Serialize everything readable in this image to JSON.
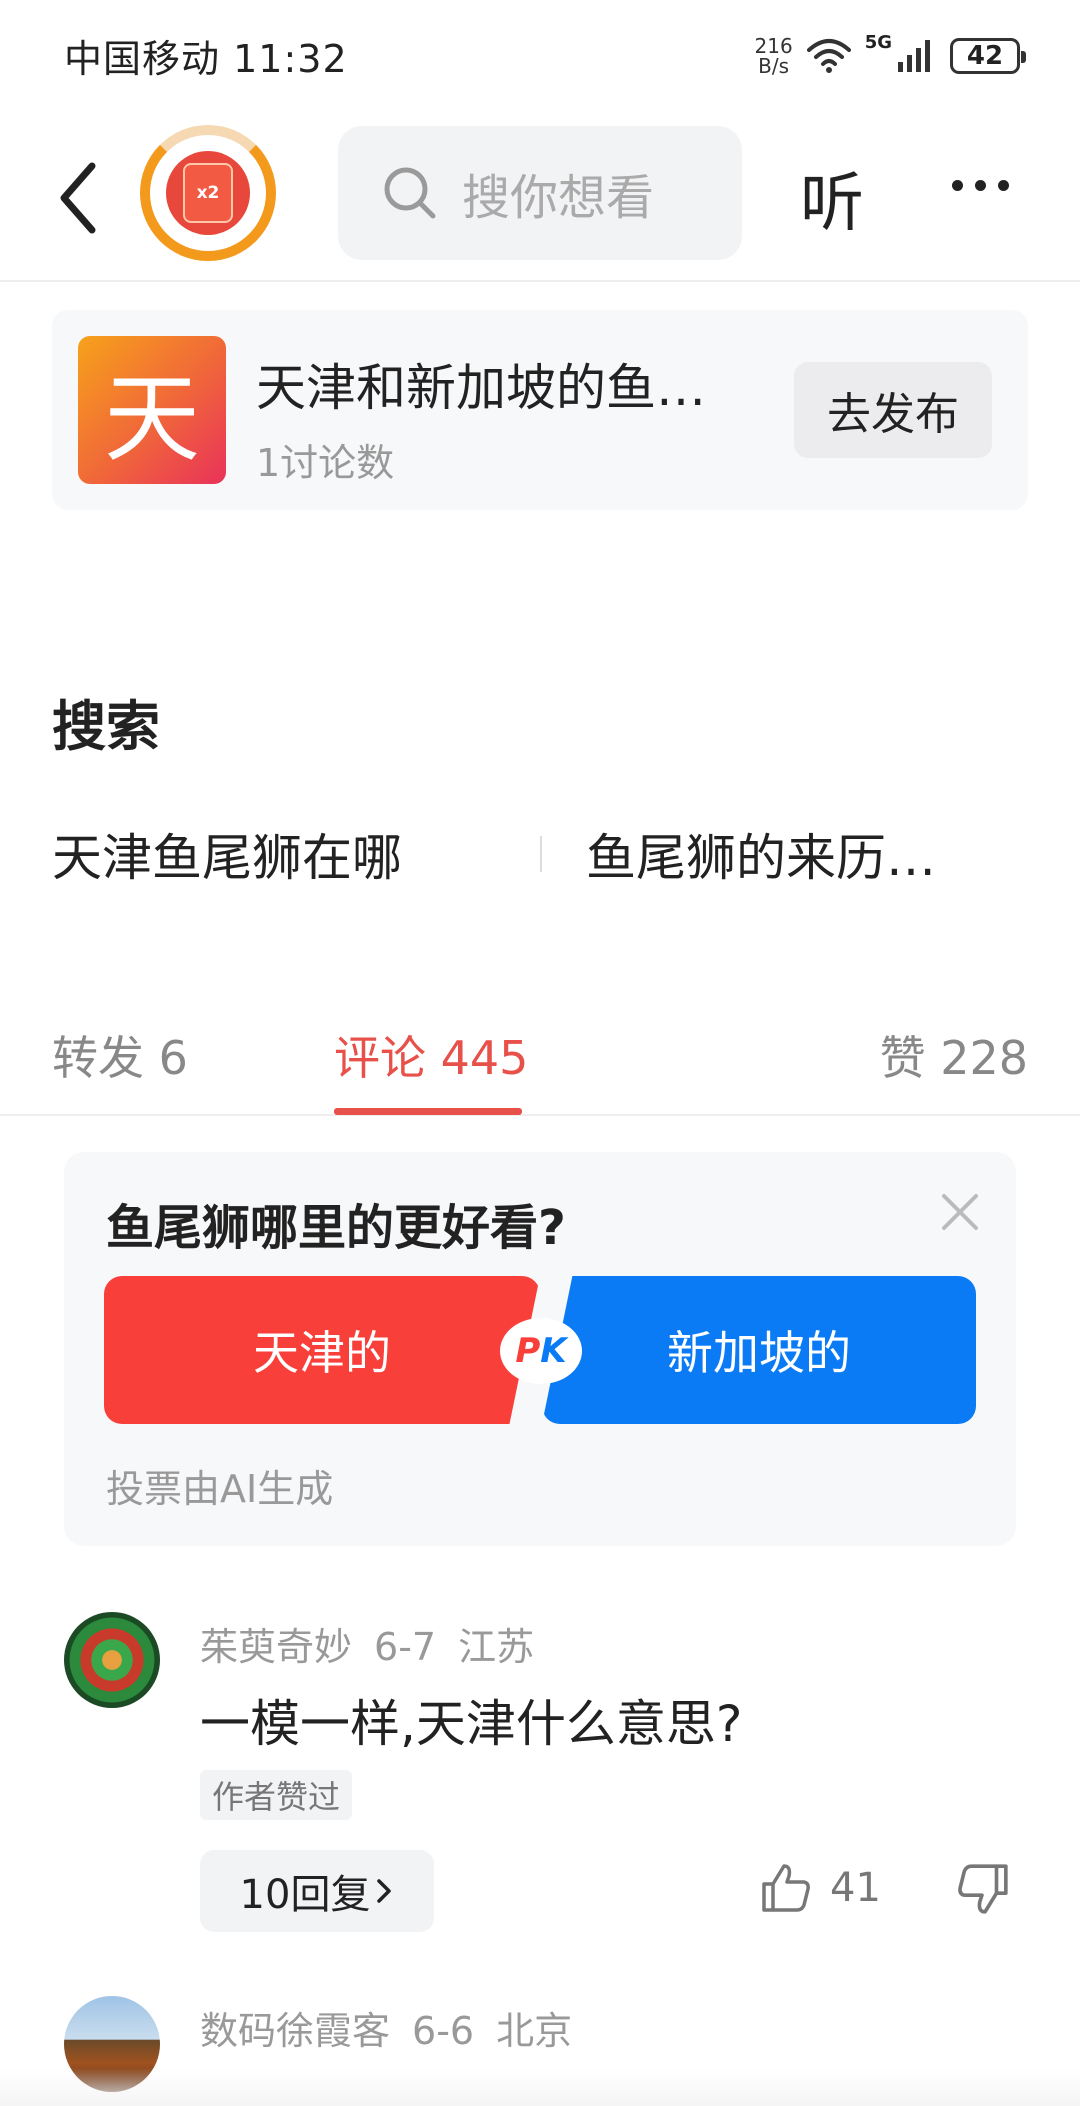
{
  "status_bar": {
    "carrier": "中国移动",
    "time": "11:32",
    "net_speed_value": "216",
    "net_speed_unit": "B/s",
    "signal_label": "5G",
    "battery": "42"
  },
  "nav": {
    "redpack_label": "x2",
    "search_placeholder": "搜你想看",
    "listen_label": "听"
  },
  "topic": {
    "thumb_char": "天",
    "title": "天津和新加坡的鱼…",
    "count": "1讨论数",
    "publish_label": "去发布"
  },
  "search": {
    "title": "搜索",
    "terms": [
      "天津鱼尾狮在哪",
      "鱼尾狮的来历…"
    ]
  },
  "tabs": [
    {
      "label": "转发 6"
    },
    {
      "label": "评论 445"
    },
    {
      "label": "赞 228"
    }
  ],
  "vote": {
    "question": "鱼尾狮哪里的更好看?",
    "option_left": "天津的",
    "option_right": "新加坡的",
    "pk_p": "P",
    "pk_k": "K",
    "note": "投票由AI生成"
  },
  "comments": [
    {
      "user": "茱萸奇妙",
      "date": "6-7",
      "location": "江苏",
      "text": "一模一样,天津什么意思?",
      "badge": "作者赞过",
      "replies": "10回复",
      "likes": "41"
    },
    {
      "user": "数码徐霞客",
      "date": "6-6",
      "location": "北京"
    }
  ],
  "colors": {
    "accent_red": "#e8504a",
    "vote_red": "#f93f3a",
    "vote_blue": "#0a7bf5",
    "redpack_ring": "#f39a1d"
  }
}
